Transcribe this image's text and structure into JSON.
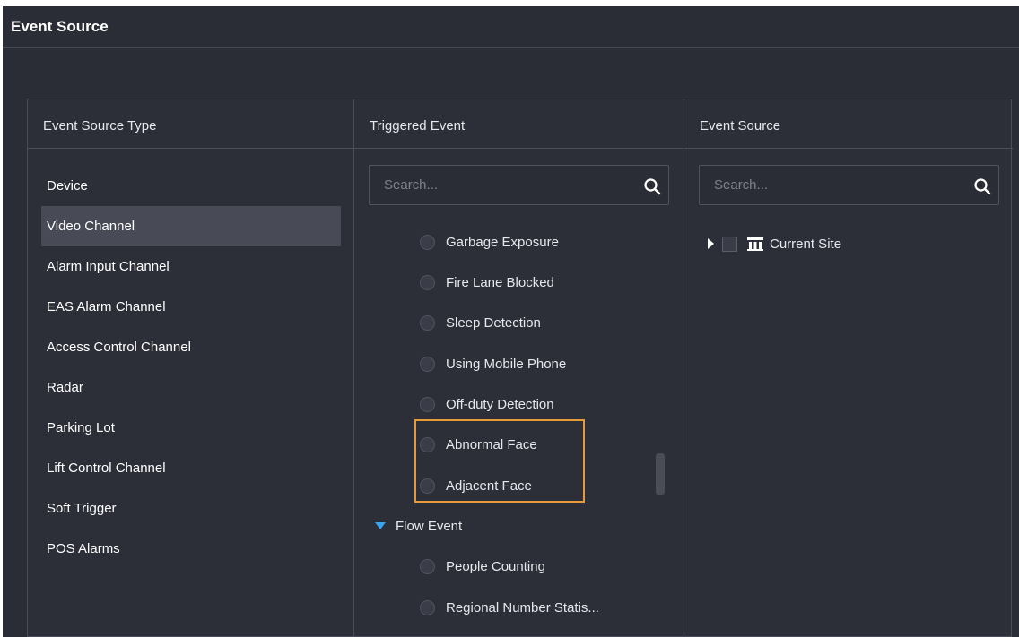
{
  "header": {
    "title": "Event Source"
  },
  "columns": {
    "type": {
      "title": "Event Source Type"
    },
    "triggered": {
      "title": "Triggered Event"
    },
    "source": {
      "title": "Event Source"
    }
  },
  "event_source_types": [
    {
      "label": "Device",
      "selected": false
    },
    {
      "label": "Video Channel",
      "selected": true
    },
    {
      "label": "Alarm Input Channel",
      "selected": false
    },
    {
      "label": "EAS Alarm Channel",
      "selected": false
    },
    {
      "label": "Access Control Channel",
      "selected": false
    },
    {
      "label": "Radar",
      "selected": false
    },
    {
      "label": "Parking Lot",
      "selected": false
    },
    {
      "label": "Lift Control Channel",
      "selected": false
    },
    {
      "label": "Soft Trigger",
      "selected": false
    },
    {
      "label": "POS Alarms",
      "selected": false
    }
  ],
  "triggered_search": {
    "placeholder": "Search..."
  },
  "triggered_events": [
    "Garbage Exposure",
    "Fire Lane Blocked",
    "Sleep Detection",
    "Using Mobile Phone",
    "Off-duty Detection",
    "Abnormal Face",
    "Adjacent Face"
  ],
  "flow_group": {
    "label": "Flow Event"
  },
  "flow_events": [
    "People Counting",
    "Regional Number Statis..."
  ],
  "source_search": {
    "placeholder": "Search..."
  },
  "tree": {
    "root_label": "Current Site"
  },
  "colors": {
    "background": "#2a2d36",
    "selected_row": "#484b55",
    "highlight_border": "#e59b3a",
    "accent_triangle": "#3aa3f0"
  },
  "icons": {
    "search": "search-icon",
    "expand": "caret-right-icon",
    "group_expanded": "caret-down-icon",
    "site": "site-icon"
  }
}
